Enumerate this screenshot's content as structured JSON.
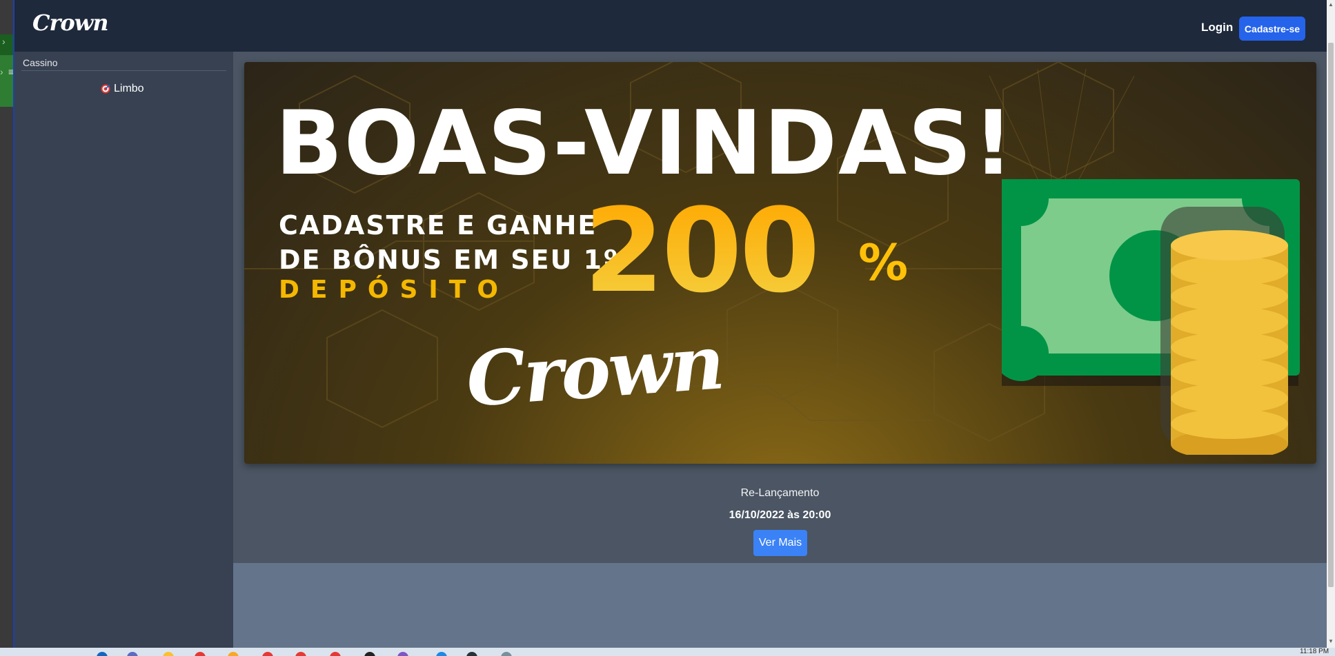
{
  "header": {
    "logo": "Crown",
    "login_label": "Login",
    "signup_label": "Cadastre-se"
  },
  "sidebar": {
    "section_title": "Cassino",
    "items": [
      {
        "label": "Limbo",
        "icon": "target-icon"
      }
    ]
  },
  "banner": {
    "headline": "BOAS-VINDAS!",
    "line1": "CADASTRE E GANHE",
    "line2": "DE BÔNUS EM SEU 1º",
    "line3": "DEPÓSITO",
    "amount": "200",
    "percent": "%",
    "brand": "Crown"
  },
  "main": {
    "relaunch_label": "Re-Lançamento",
    "date_label": "16/10/2022 às 20:00",
    "more_button": "Ver Mais"
  },
  "taskbar": {
    "clock": "11:18 PM"
  },
  "colors": {
    "header_bg": "#1e293b",
    "sidebar_bg": "#374151",
    "main_bg": "#4b5563",
    "accent_blue": "#2563eb",
    "gold": "#ffc107"
  }
}
